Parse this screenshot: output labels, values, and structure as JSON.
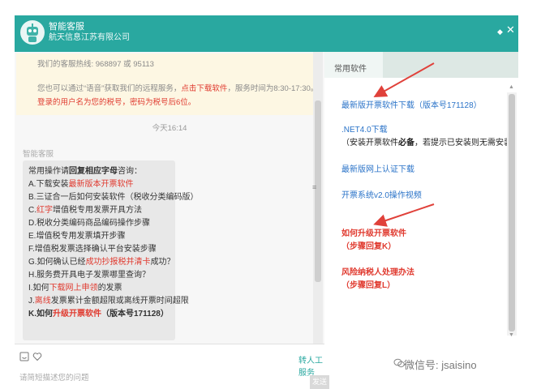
{
  "header": {
    "title": "智能客服",
    "subtitle": "航天信息江苏有限公司",
    "pin_symbol": "◆",
    "close_symbol": "✕"
  },
  "notice": {
    "hotline": "我们的客服热线: 968897 或 95113",
    "remote_pre": "您也可以通过“语音”获取我们的远程服务，",
    "remote_link": "点击下载软件",
    "remote_post": "，服务时间为8:30-17:30。",
    "login_tip": "登录的用户名为您的税号，密码为税号后6位。"
  },
  "chat": {
    "time": "今天16:14",
    "agent_name": "智能客服",
    "mid_marker": "≡",
    "intro_pre": "常用操作请",
    "intro_bold": "回复相应字母",
    "intro_post": "咨询：",
    "items": [
      {
        "pre": "A.下载安装",
        "hl": "最新版本开票软件",
        "post": ""
      },
      {
        "pre": "B.三证合一后如何安装软件（税收分类编码版）",
        "hl": "",
        "post": ""
      },
      {
        "pre": "C.",
        "hl": "红字",
        "post": "增值税专用发票开具方法"
      },
      {
        "pre": "D.税收分类编码商品编码操作步骤",
        "hl": "",
        "post": ""
      },
      {
        "pre": "E.增值税专用发票填开步骤",
        "hl": "",
        "post": ""
      },
      {
        "pre": "F.增值税发票选择确认平台安装步骤",
        "hl": "",
        "post": ""
      },
      {
        "pre": "G.如何确认已经",
        "hl": "成功抄报税并清卡",
        "post": "成功？"
      },
      {
        "pre": "H.服务费开具电子发票哪里查询？",
        "hl": "",
        "post": ""
      },
      {
        "pre": "I.如何",
        "hl": "下载网上申领",
        "post": "的发票"
      },
      {
        "pre": "J.",
        "hl": "离线",
        "post": "发票累计金额超限或离线开票时间超限"
      }
    ],
    "last_item": {
      "pre": "K.如何",
      "hl": "升级开票软件",
      "post": "（版本号171128）"
    }
  },
  "input": {
    "human_service": "转人工服务",
    "placeholder": "请简短描述您的问题",
    "send": "发送"
  },
  "right_panel": {
    "tab": "常用软件",
    "links": [
      {
        "text": "最新版开票软件下载（版本号171128）",
        "style": "blue"
      },
      {
        "text": ".NET4.0下载",
        "style": "blue"
      },
      {
        "text": "（安装开票软件",
        "bold": "必备",
        "post": "，若提示已安装则无需安装）",
        "style": "black"
      },
      {
        "text": "最新版网上认证下载",
        "style": "blue"
      },
      {
        "text": "开票系统v2.0操作视频",
        "style": "blue"
      },
      {
        "text": "如何升级开票软件",
        "style": "red"
      },
      {
        "text": "（步骤回复K）",
        "style": "red"
      },
      {
        "text": "风险纳税人处理办法",
        "style": "red"
      },
      {
        "text": "（步骤回复L）",
        "style": "red"
      }
    ]
  },
  "watermark": {
    "text": "微信号: jsaisino",
    "icon": "wechat-icon"
  },
  "colors": {
    "header": "#29a8a0",
    "link": "#2a73c8",
    "highlight": "#e03a2f",
    "notice_bg": "#fdf7e3",
    "arrow": "#e0413a"
  }
}
